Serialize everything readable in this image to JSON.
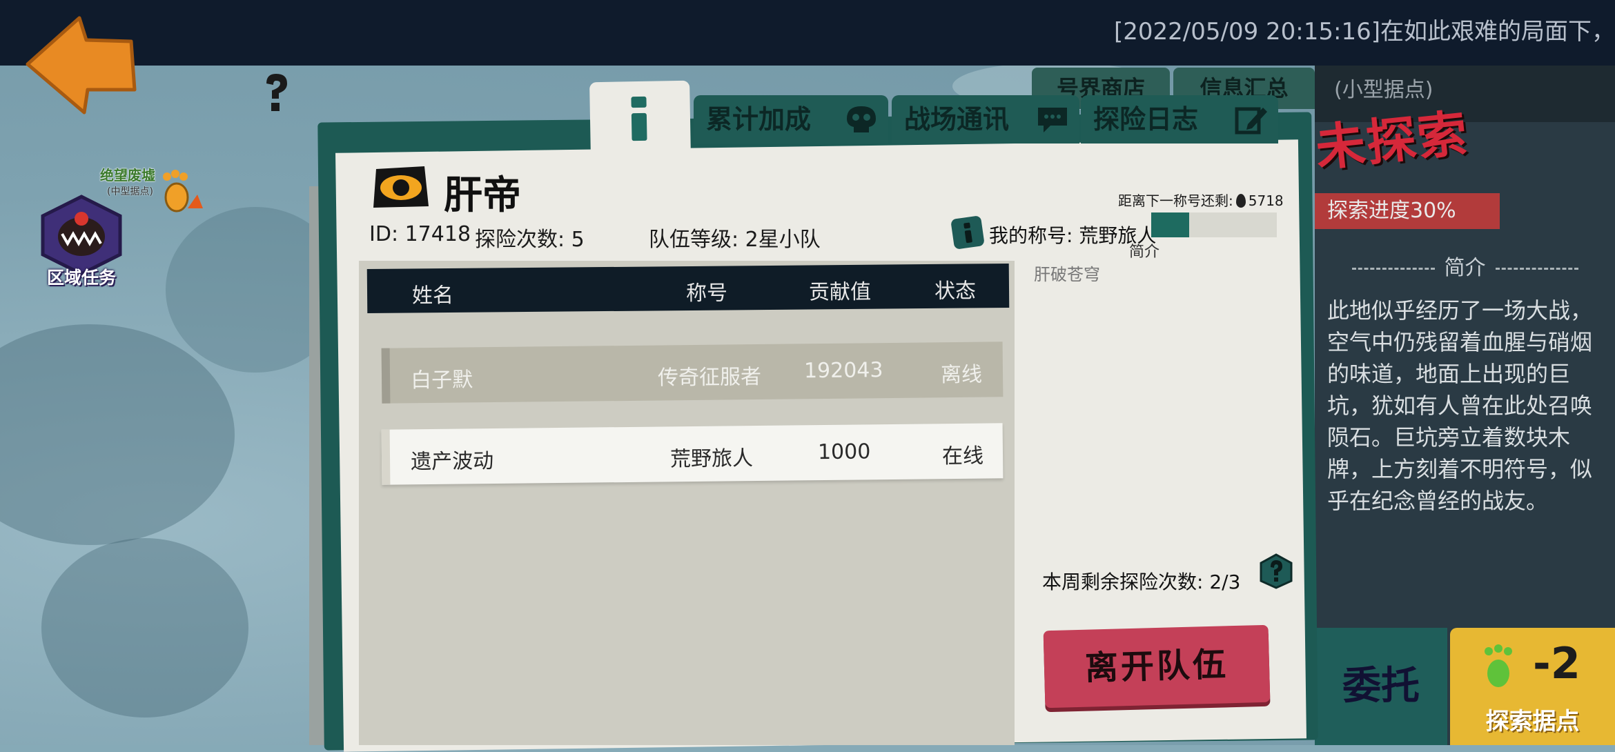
{
  "ticker": "[2022/05/09 20:15:16]在如此艰难的局面下，",
  "tabs": {
    "bonus": "累计加成",
    "comm": "战场通讯",
    "log": "探险日志"
  },
  "top_right_tabs": [
    "号界商店",
    "信息汇总"
  ],
  "left": {
    "region_task": "区域任务",
    "location_name": "绝望废墟",
    "location_type": "(中型据点)"
  },
  "team": {
    "name": "肝帝",
    "id_label": "ID: 17418",
    "expeditions_label": "探险次数: 5",
    "level_label": "队伍等级: 2星小队",
    "next_title_label": "距离下一称号还剩:",
    "next_title_value": "5718",
    "my_title_label": "我的称号: 荒野旅人",
    "title_progress": 0.3,
    "intro_label": "简介",
    "title_name": "肝破苍穹"
  },
  "table": {
    "headers": [
      "姓名",
      "称号",
      "贡献值",
      "状态"
    ],
    "rows": [
      {
        "name": "白子默",
        "title": "传奇征服者",
        "contribution": "192043",
        "status": "离线"
      },
      {
        "name": "遗产波动",
        "title": "荒野旅人",
        "contribution": "1000",
        "status": "在线"
      }
    ]
  },
  "weekly_remaining": "本周剩余探险次数: 2/3",
  "leave_button": "离开队伍",
  "right": {
    "type": "(小型据点)",
    "status": "未探索",
    "progress_label": "探索进度30%",
    "intro_title": "简介",
    "description": "此地似乎经历了一场大战，空气中仍残留着血腥与硝烟的味道，地面上出现的巨坑，犹如有人曾在此处召唤陨石。巨坑旁立着数块木牌，上方刻着不明符号，似乎在纪念曾经的战友。",
    "commission": "委托",
    "explore_cost": "-2",
    "explore_label": "探索据点"
  },
  "colors": {
    "panel_teal": "#1d5a54",
    "leave_red": "#c44058",
    "status_red": "#d6283a",
    "explore_yellow": "#e7b833"
  }
}
